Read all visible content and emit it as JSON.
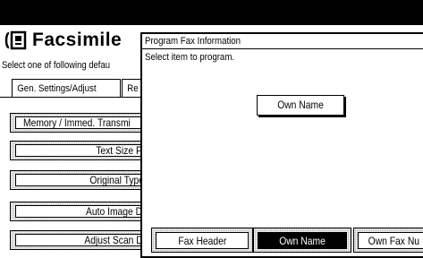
{
  "app": {
    "title": "Facsimile",
    "instruction": "Select one of following defau"
  },
  "tabs": [
    {
      "label": "Gen. Settings/Adjust"
    },
    {
      "label": "Re"
    }
  ],
  "menu": [
    {
      "label": "Memory / Immed. Transmi"
    },
    {
      "label": "Text Size Priori"
    },
    {
      "label": "Original Type Pri"
    },
    {
      "label": "Auto Image Dens"
    },
    {
      "label": "Adjust Scan Dens"
    }
  ],
  "dialog": {
    "title": "Program Fax Information",
    "prompt": "Select item to program.",
    "current_item_label": "Own Name",
    "options": [
      {
        "label": "Fax Header",
        "selected": false
      },
      {
        "label": "Own Name",
        "selected": true
      },
      {
        "label": "Own Fax Nu",
        "selected": false
      }
    ]
  },
  "icons": {
    "app_icon": "fax-machine-icon"
  }
}
